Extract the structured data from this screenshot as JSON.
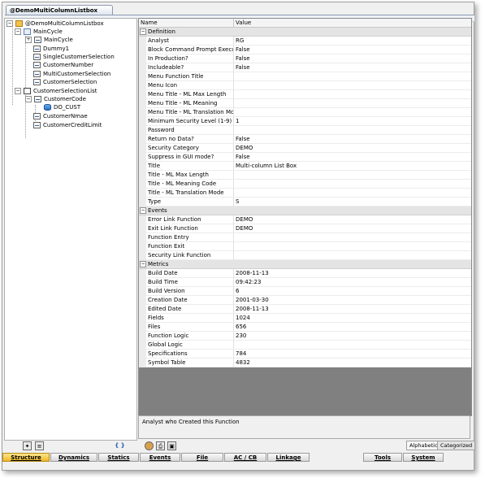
{
  "window": {
    "document_tab": "@DemoMultiColumnListbox"
  },
  "tree": {
    "root": "@DemoMultiColumnListbox",
    "nodes": [
      {
        "label": "MainCycle",
        "icon": "cycle-icon"
      },
      {
        "label": "MainCycle",
        "icon": "field-icon"
      },
      {
        "label": "Dummy1",
        "icon": "field-icon"
      },
      {
        "label": "SingleCustomerSelection",
        "icon": "field-icon"
      },
      {
        "label": "CustomerNumber",
        "icon": "field-icon"
      },
      {
        "label": "MultiCustomerSelection",
        "icon": "field-icon"
      },
      {
        "label": "CustomerSelection",
        "icon": "field-icon"
      },
      {
        "label": "CustomerSelectionList",
        "icon": "list-icon"
      },
      {
        "label": "CustomerCode",
        "icon": "field-icon"
      },
      {
        "label": "DO_CUST",
        "icon": "database-icon"
      },
      {
        "label": "CustomerNmae",
        "icon": "field-icon"
      },
      {
        "label": "CustomerCreditLimit",
        "icon": "field-icon"
      }
    ]
  },
  "grid": {
    "header": {
      "name": "Name",
      "value": "Value"
    },
    "categories": [
      {
        "label": "Definition",
        "rows": [
          {
            "name": "Analyst",
            "value": "RG"
          },
          {
            "name": "Block Command Prompt Execution",
            "value": "False"
          },
          {
            "name": "In Production?",
            "value": "False"
          },
          {
            "name": "Includeable?",
            "value": "False"
          },
          {
            "name": "Menu Function Title",
            "value": ""
          },
          {
            "name": "Menu Icon",
            "value": ""
          },
          {
            "name": "Menu Title - ML Max Length",
            "value": ""
          },
          {
            "name": "Menu Title - ML Meaning",
            "value": ""
          },
          {
            "name": "Menu Title - ML Translation Mode",
            "value": ""
          },
          {
            "name": "Minimum Security Level (1-9)",
            "value": "1"
          },
          {
            "name": "Password",
            "value": ""
          },
          {
            "name": "Return no Data?",
            "value": "False"
          },
          {
            "name": "Security Category",
            "value": "DEMO"
          },
          {
            "name": "Suppress in GUI mode?",
            "value": "False"
          },
          {
            "name": "Title",
            "value": "Multi-column List Box"
          },
          {
            "name": "Title - ML Max Length",
            "value": ""
          },
          {
            "name": "Title - ML Meaning Code",
            "value": ""
          },
          {
            "name": "Title - ML Translation Mode",
            "value": ""
          },
          {
            "name": "Type",
            "value": "S"
          }
        ]
      },
      {
        "label": "Events",
        "rows": [
          {
            "name": "Error Link Function",
            "value": "DEMO"
          },
          {
            "name": "Exit Link Function",
            "value": "DEMO"
          },
          {
            "name": "Function Entry",
            "value": ""
          },
          {
            "name": "Function Exit",
            "value": ""
          },
          {
            "name": "Security Link Function",
            "value": ""
          }
        ]
      },
      {
        "label": "Metrics",
        "rows": [
          {
            "name": "Build Date",
            "value": "2008-11-13"
          },
          {
            "name": "Build Time",
            "value": "09:42:23"
          },
          {
            "name": "Build Version",
            "value": "6"
          },
          {
            "name": "Creation Date",
            "value": "2001-03-30"
          },
          {
            "name": "Edited Date",
            "value": "2008-11-13"
          },
          {
            "name": "Fields",
            "value": "1024"
          },
          {
            "name": "Files",
            "value": "656"
          },
          {
            "name": "Function Logic",
            "value": "230"
          },
          {
            "name": "Global Logic",
            "value": ""
          },
          {
            "name": "Specifications",
            "value": "784"
          },
          {
            "name": "Symbol Table",
            "value": "4832"
          }
        ]
      }
    ]
  },
  "description": "Analyst who Created this Function",
  "sort_buttons": {
    "alphabetic": "Alphabetic",
    "categorized": "Categorized"
  },
  "toolbar": {
    "braces_glyph": "{ }"
  },
  "nav_tabs": [
    "Structure",
    "Dynamics",
    "Statics",
    "Events",
    "File",
    "AC / CB",
    "Linkage",
    "Tools",
    "System"
  ],
  "nav_active": "Structure"
}
